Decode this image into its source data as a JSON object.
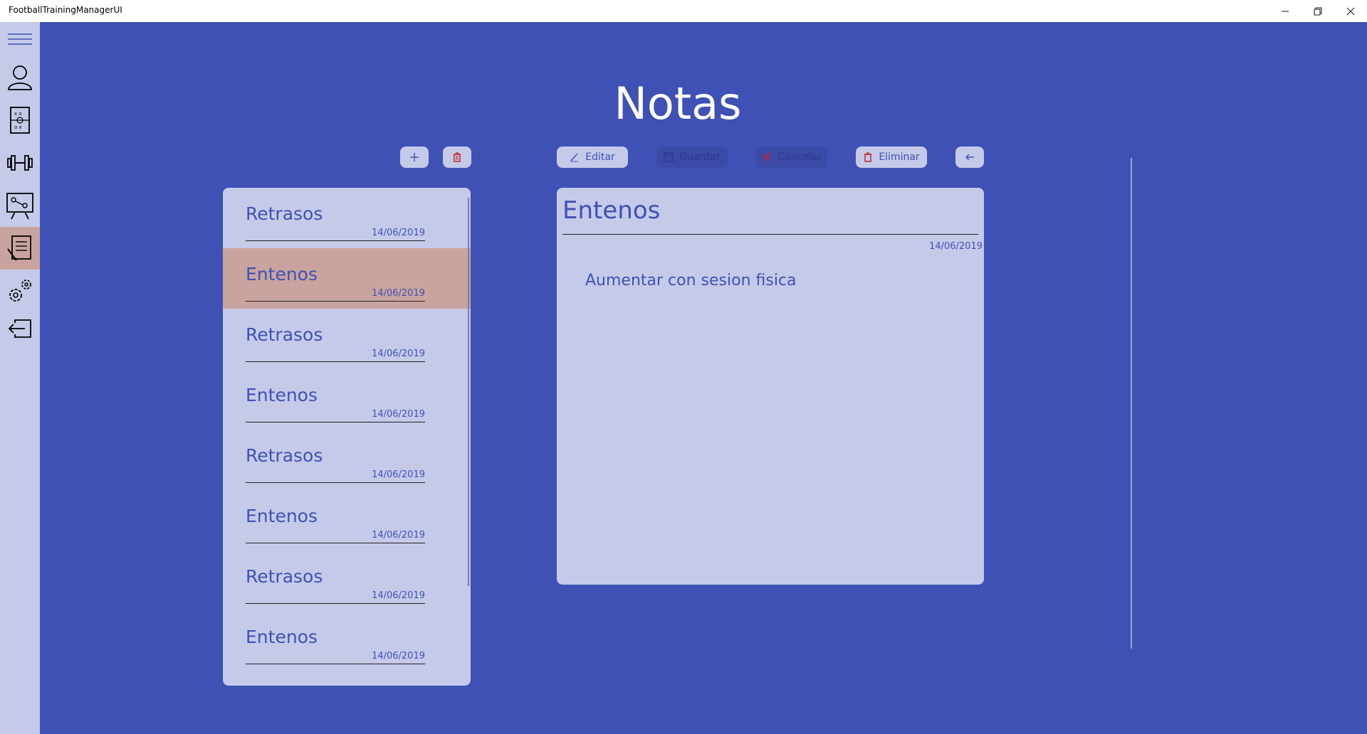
{
  "window": {
    "title": "FootballTrainingManagerUI"
  },
  "sidebar": {
    "items": [
      {
        "icon": "hamburger-menu-icon"
      },
      {
        "icon": "person-icon"
      },
      {
        "icon": "tactics-board-icon"
      },
      {
        "icon": "dumbbell-icon"
      },
      {
        "icon": "training-board-icon"
      },
      {
        "icon": "notes-icon",
        "active": true
      },
      {
        "icon": "settings-gears-icon"
      },
      {
        "icon": "logout-icon"
      }
    ]
  },
  "page": {
    "title": "Notas"
  },
  "toolbar": {
    "edit_label": "Editar",
    "save_label": "Guardar",
    "cancel_label": "Cancelar",
    "delete_label": "Eliminar"
  },
  "notes": [
    {
      "title": "Retrasos",
      "date": "14/06/2019"
    },
    {
      "title": "Entenos",
      "date": "14/06/2019",
      "selected": true
    },
    {
      "title": "Retrasos",
      "date": "14/06/2019"
    },
    {
      "title": "Entenos",
      "date": "14/06/2019"
    },
    {
      "title": "Retrasos",
      "date": "14/06/2019"
    },
    {
      "title": "Entenos",
      "date": "14/06/2019"
    },
    {
      "title": "Retrasos",
      "date": "14/06/2019"
    },
    {
      "title": "Entenos",
      "date": "14/06/2019"
    }
  ],
  "detail": {
    "title": "Entenos",
    "date": "14/06/2019",
    "body": "Aumentar con sesion fisica"
  },
  "colors": {
    "background": "#3f51b5",
    "panel": "#c5cae9",
    "selected": "#c9a49e",
    "delete_red": "#c62828"
  }
}
